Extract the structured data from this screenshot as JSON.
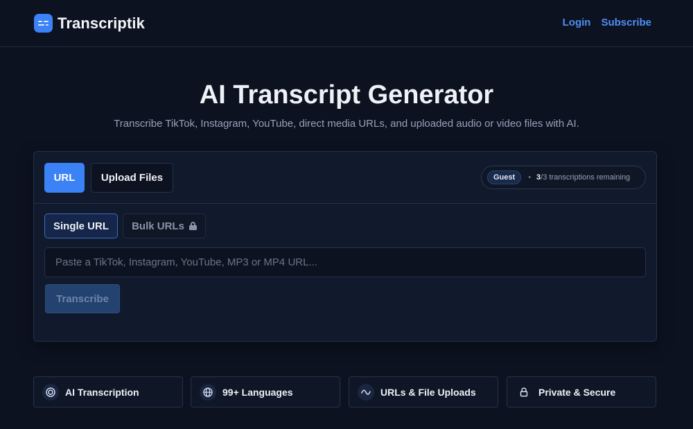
{
  "app": {
    "name": "Transcriptik"
  },
  "nav": {
    "login": "Login",
    "subscribe": "Subscribe"
  },
  "hero": {
    "title": "AI Transcript Generator",
    "subtitle": "Transcribe TikTok, Instagram, YouTube, direct media URLs, and uploaded audio or video files with AI."
  },
  "tabs": {
    "url": "URL",
    "upload": "Upload Files",
    "active": "URL"
  },
  "usage": {
    "plan": "Guest",
    "separator": "•",
    "used": "3",
    "total": "/3 transcriptions remaining"
  },
  "subtabs": {
    "single": "Single URL",
    "bulk": "Bulk URLs",
    "bulk_icon": "lock-icon",
    "active": "Single URL"
  },
  "input": {
    "placeholder": "Paste a TikTok, Instagram, YouTube, MP3 or MP4 URL...",
    "value": ""
  },
  "actions": {
    "transcribe": "Transcribe"
  },
  "features": [
    {
      "label": "AI Transcription",
      "icon": "target-icon"
    },
    {
      "label": "99+ Languages",
      "icon": "globe-icon"
    },
    {
      "label": "URLs & File Uploads",
      "icon": "wave-icon"
    },
    {
      "label": "Private & Secure",
      "icon": "lock-icon"
    }
  ],
  "colors": {
    "background": "#0c1220",
    "accent": "#3b82f6",
    "link": "#4f8ff7",
    "card": "#111a2c"
  }
}
